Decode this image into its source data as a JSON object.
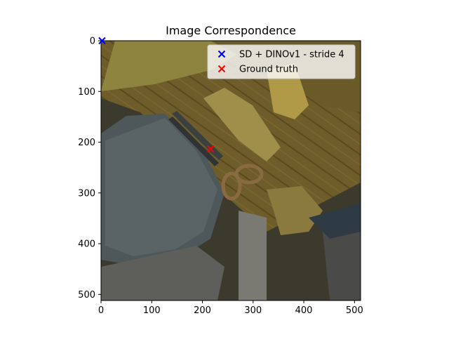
{
  "chart_data": {
    "type": "scatter",
    "title": "Image Correspondence",
    "xlabel": "",
    "ylabel": "",
    "xlim": [
      0,
      512
    ],
    "ylim": [
      512,
      0
    ],
    "xticks": [
      0,
      100,
      200,
      300,
      400,
      500
    ],
    "yticks": [
      0,
      100,
      200,
      300,
      400,
      500
    ],
    "background": "photo of scissors on a wooden surface next to a ceramic vase (dimmed)",
    "legend_location": "top-right",
    "series": [
      {
        "name": "SD + DINOv1 - stride 4",
        "marker": "x",
        "color": "#0000ff",
        "points": [
          {
            "x": 2,
            "y": 0
          }
        ]
      },
      {
        "name": "Ground truth",
        "marker": "x",
        "color": "#ff0000",
        "points": [
          {
            "x": 216,
            "y": 213
          }
        ]
      }
    ]
  }
}
